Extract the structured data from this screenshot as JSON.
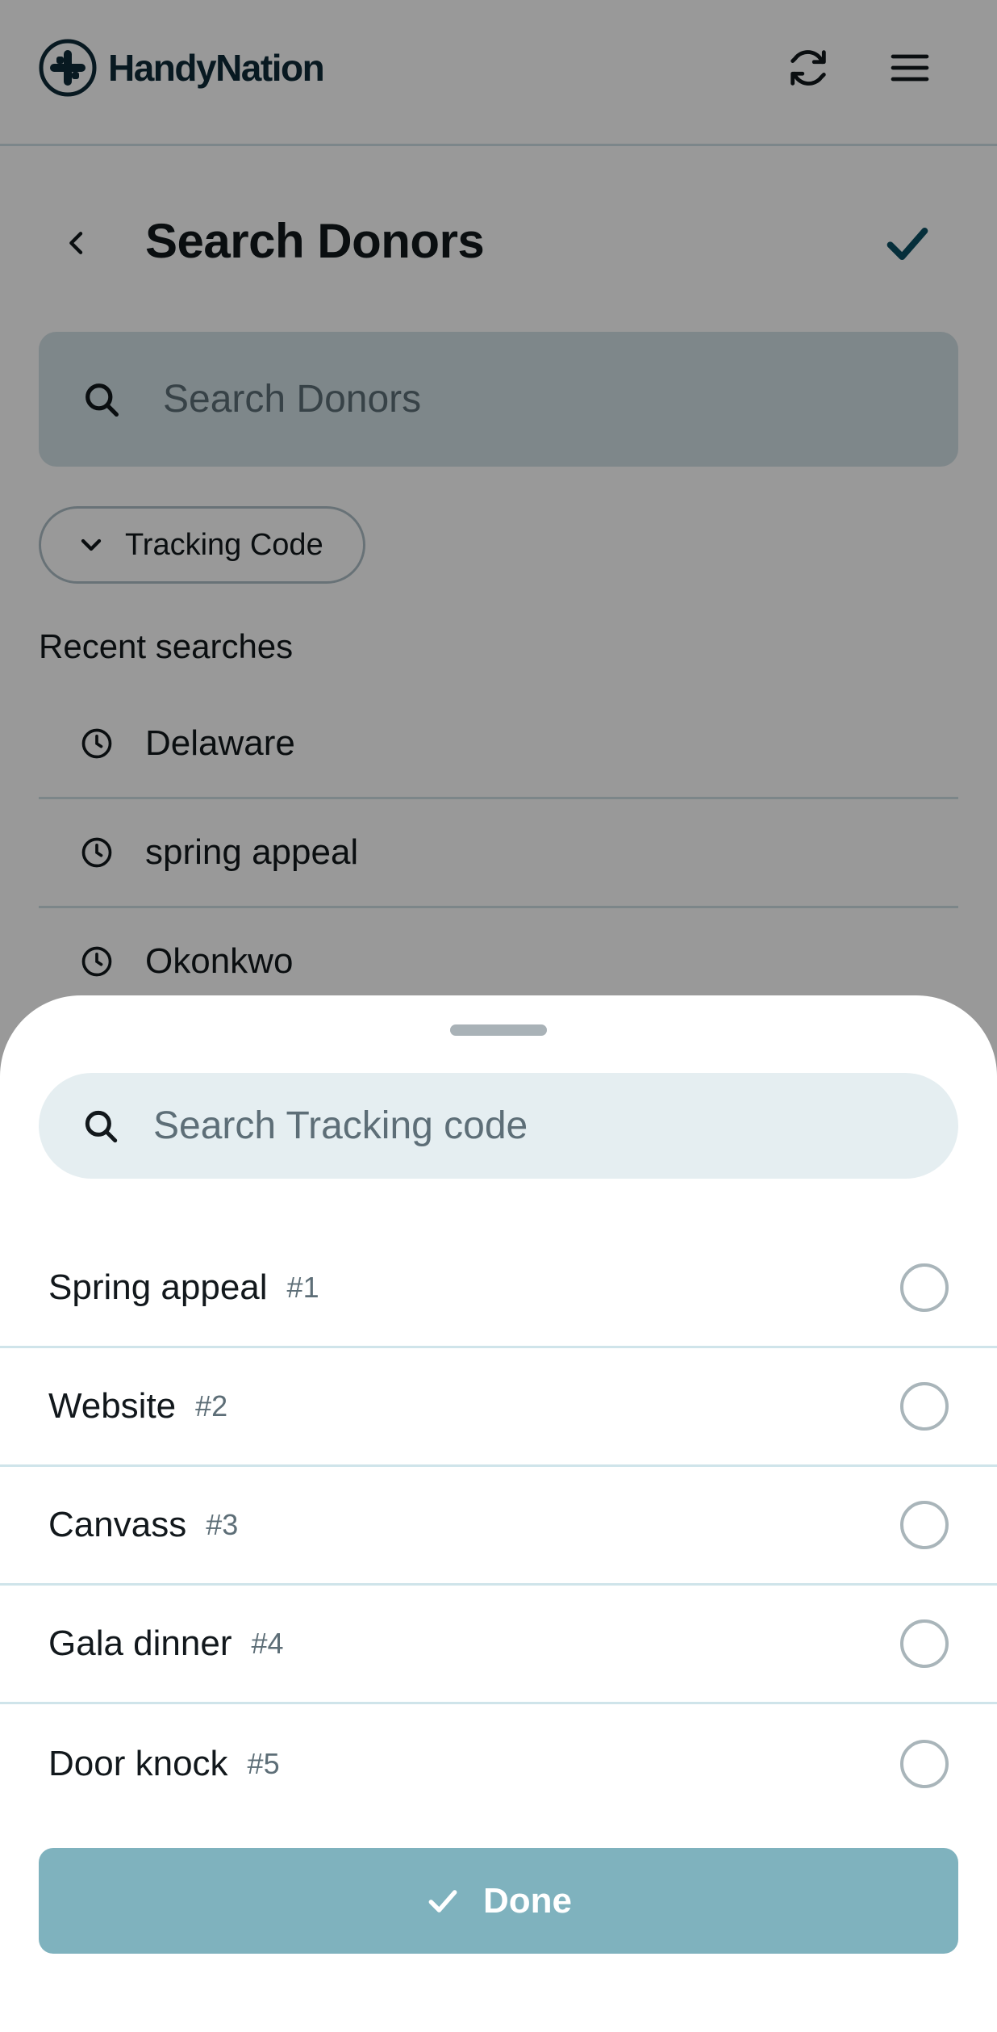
{
  "colors": {
    "brand_dark": "#0e2a38",
    "accent": "#0b4f63",
    "done_button": "#7fb2be",
    "search_bg": "#d3e1e6",
    "sheet_search_bg": "#e5eef1"
  },
  "app": {
    "name": "HandyNation",
    "icons": {
      "logo": "handynation-logo-icon",
      "refresh": "refresh-icon",
      "menu": "hamburger-menu-icon"
    }
  },
  "header": {
    "title": "Search Donors",
    "back_icon": "chevron-left-icon",
    "confirm_icon": "checkmark-icon"
  },
  "donor_search": {
    "placeholder": "Search Donors",
    "icon": "search-icon"
  },
  "filter_chip": {
    "label": "Tracking Code",
    "icon": "chevron-down-icon"
  },
  "recent": {
    "label": "Recent searches",
    "icon": "clock-icon",
    "items": [
      {
        "text": "Delaware"
      },
      {
        "text": "spring appeal"
      },
      {
        "text": "Okonkwo"
      }
    ]
  },
  "sheet": {
    "search_placeholder": "Search Tracking code",
    "options": [
      {
        "name": "Spring appeal",
        "num": "#1",
        "selected": false
      },
      {
        "name": "Website",
        "num": "#2",
        "selected": false
      },
      {
        "name": "Canvass",
        "num": "#3",
        "selected": false
      },
      {
        "name": "Gala dinner",
        "num": "#4",
        "selected": false
      },
      {
        "name": "Door knock",
        "num": "#5",
        "selected": false
      }
    ],
    "done_label": "Done",
    "done_icon": "checkmark-icon"
  }
}
